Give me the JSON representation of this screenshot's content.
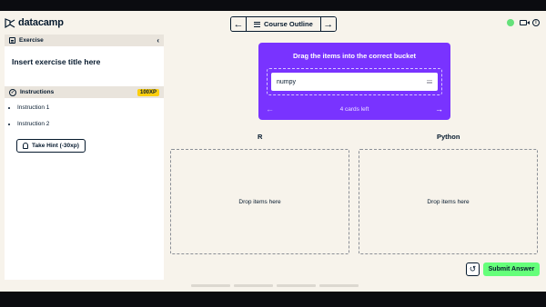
{
  "header": {
    "logo_text": "datacamp",
    "prev_icon": "arrow-left-icon",
    "next_icon": "arrow-right-icon",
    "outline_label": "Course Outline",
    "colors": {
      "status": "#65e17a"
    }
  },
  "sidebar": {
    "exercise_label": "Exercise",
    "collapse_icon": "chevron-left-icon",
    "exercise_title": "Insert exercise title here",
    "instructions_label": "Instructions",
    "xp_badge": "100XP",
    "instructions": [
      "Instruction 1",
      "Instruction 2"
    ],
    "hint_label": "Take Hint (-30xp)"
  },
  "tray": {
    "title": "Drag the items into the correct bucket",
    "card_text": "numpy",
    "cards_left": "4 cards left",
    "colors": {
      "background": "#7933ff"
    }
  },
  "buckets": [
    {
      "label": "R",
      "placeholder": "Drop items here"
    },
    {
      "label": "Python",
      "placeholder": "Drop items here"
    }
  ],
  "footer": {
    "submit_label": "Submit Answer",
    "reset_icon": "reset-icon",
    "colors": {
      "submit": "#65ff7a"
    }
  }
}
